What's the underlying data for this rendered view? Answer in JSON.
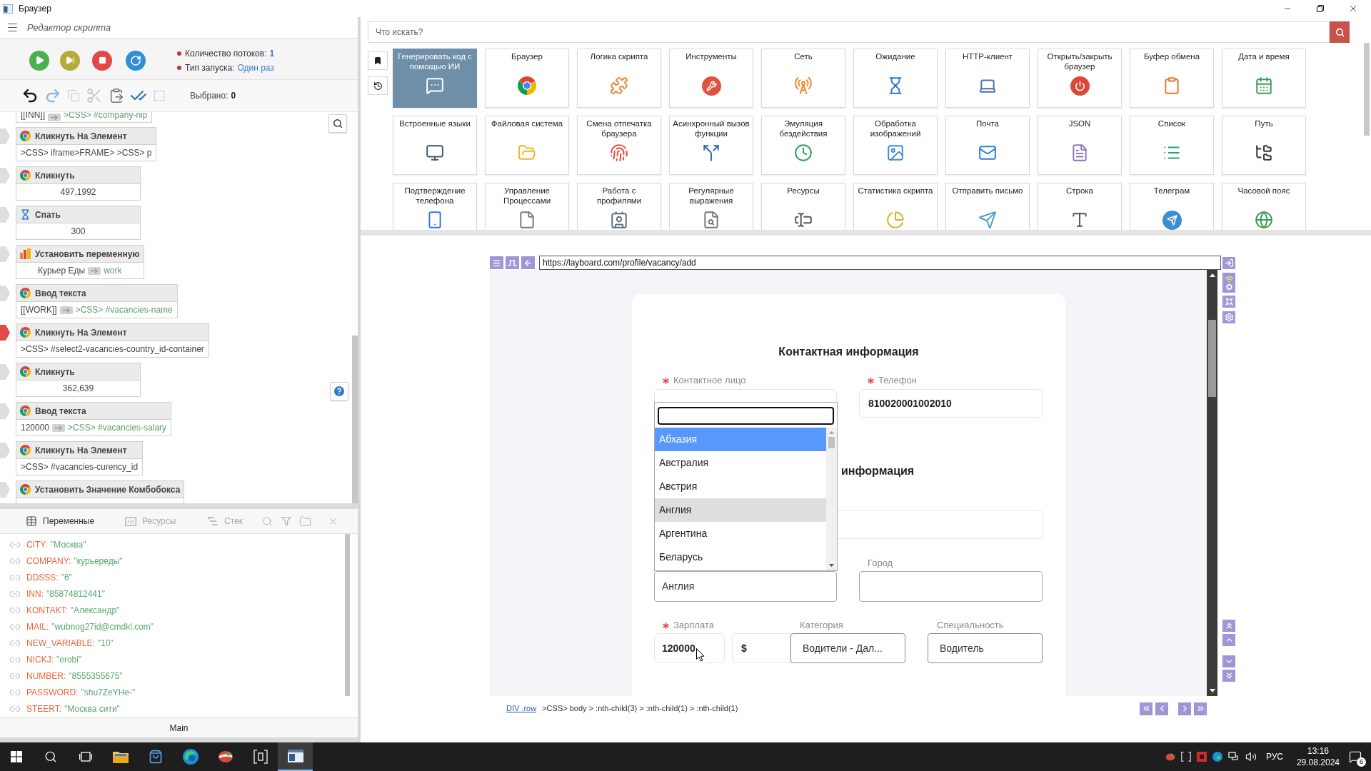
{
  "window": {
    "title": "Браузер"
  },
  "editor": {
    "title": "Редактор скрипта",
    "threads_label": "Количество потоков:",
    "threads_value": "1",
    "launch_label": "Тип запуска:",
    "launch_value": "Один раз",
    "selected_label": "Выбрано:",
    "selected_value": "0",
    "top_parameter": {
      "text": "[[INN]]",
      "target": ">CSS> #company-nip"
    },
    "blocks": [
      {
        "kind": "browser",
        "title": "Кликнуть На Элемент",
        "current": false,
        "body": {
          "text": ">CSS> iframe>FRAME> >CSS> p"
        }
      },
      {
        "kind": "browser",
        "title": "Кликнуть",
        "current": false,
        "body": {
          "text": "497,1992"
        }
      },
      {
        "kind": "wait",
        "title": "Спать",
        "current": false,
        "body": {
          "text": "300"
        }
      },
      {
        "kind": "variable",
        "title": "Установить переменную",
        "current": false,
        "body": {
          "text": "Курьер Еды",
          "target": "work"
        }
      },
      {
        "kind": "browser",
        "title": "Ввод текста",
        "current": false,
        "body": {
          "text": "[[WORK]]",
          "target": ">CSS> #vacancies-name"
        }
      },
      {
        "kind": "browser",
        "title": "Кликнуть На Элемент",
        "current": true,
        "body": {
          "text": ">CSS> #select2-vacancies-country_id-container"
        }
      },
      {
        "kind": "browser",
        "title": "Кликнуть",
        "current": false,
        "body": {
          "text": "362,639"
        }
      },
      {
        "kind": "browser",
        "title": "Ввод текста",
        "current": false,
        "body": {
          "text": "120000",
          "target": ">CSS> #vacancies-salary"
        }
      },
      {
        "kind": "browser",
        "title": "Кликнуть На Элемент",
        "current": false,
        "body": {
          "text": ">CSS> #vacancies-curency_id"
        }
      },
      {
        "kind": "browser",
        "title": "Установить Значение Комбобокса",
        "current": false
      }
    ]
  },
  "variables": {
    "tabs": [
      {
        "label": "Переменные",
        "selected": true
      },
      {
        "label": "Ресурсы",
        "selected": false
      },
      {
        "label": "Стек",
        "selected": false
      }
    ],
    "items": [
      {
        "name": "CITY:",
        "value": "\"Москва\""
      },
      {
        "name": "COMPANY:",
        "value": "\"курьереды\""
      },
      {
        "name": "DDSSS:",
        "value": "\"6\""
      },
      {
        "name": "INN:",
        "value": "\"85874812441\""
      },
      {
        "name": "KONTAKT:",
        "value": "\"Александр\""
      },
      {
        "name": "MAIL:",
        "value": "\"wubnog27id@cmdkl.com\""
      },
      {
        "name": "NEW_VARIABLE:",
        "value": "\"10\""
      },
      {
        "name": "NICKJ:",
        "value": "\"erobi\""
      },
      {
        "name": "NUMBER:",
        "value": "\"8555355675\""
      },
      {
        "name": "PASSWORD:",
        "value": "\"shu7ZeYHe-\""
      },
      {
        "name": "STEERT:",
        "value": "\"Москва сити\""
      }
    ],
    "footer": "Main"
  },
  "toolbox": {
    "search_placeholder": "Что искать?",
    "tiles": [
      {
        "label": "Генерировать код с помощью ИИ",
        "featured": true
      },
      {
        "label": "Браузер",
        "featured": false
      },
      {
        "label": "Логика скрипта",
        "featured": false
      },
      {
        "label": "Инструменты",
        "featured": false
      },
      {
        "label": "Сеть",
        "featured": false
      },
      {
        "label": "Ожидание",
        "featured": false
      },
      {
        "label": "HTTP-клиент",
        "featured": false
      },
      {
        "label": "Открыть/закрыть браузер",
        "featured": false
      },
      {
        "label": "Буфер обмена",
        "featured": false
      },
      {
        "label": "Дата и время",
        "featured": false
      },
      {
        "label": "Встроенные языки",
        "featured": false
      },
      {
        "label": "Файловая система",
        "featured": false
      },
      {
        "label": "Смена отпечатка браузера",
        "featured": false
      },
      {
        "label": "Асинхронный вызов функции",
        "featured": false
      },
      {
        "label": "Эмуляция бездействия",
        "featured": false
      },
      {
        "label": "Обработка изображений",
        "featured": false
      },
      {
        "label": "Почта",
        "featured": false
      },
      {
        "label": "JSON",
        "featured": false
      },
      {
        "label": "Список",
        "featured": false
      },
      {
        "label": "Путь",
        "featured": false
      },
      {
        "label": "Подтверждение телефона",
        "featured": false
      },
      {
        "label": "Управление Процессами",
        "featured": false
      },
      {
        "label": "Работа с профилями",
        "featured": false
      },
      {
        "label": "Регулярные выражения",
        "featured": false
      },
      {
        "label": "Ресурсы",
        "featured": false
      },
      {
        "label": "Статистика скрипта",
        "featured": false
      },
      {
        "label": "Отправить письмо",
        "featured": false
      },
      {
        "label": "Строка",
        "featured": false
      },
      {
        "label": "Телеграм",
        "featured": false
      },
      {
        "label": "Часовой пояс",
        "featured": false
      }
    ]
  },
  "page": {
    "url": "https://layboard.com/profile/vacancy/add",
    "section_title": "Контактная информация",
    "contact": {
      "label": "Контактное лицо",
      "required": true
    },
    "phone": {
      "label": "Телефон",
      "required": true,
      "value": "810020001002010"
    },
    "dropdown": {
      "options": [
        {
          "label": "Абхазия",
          "selected": true,
          "hovered": false
        },
        {
          "label": "Австралия",
          "selected": false,
          "hovered": false
        },
        {
          "label": "Австрия",
          "selected": false,
          "hovered": false
        },
        {
          "label": "Англия",
          "selected": false,
          "hovered": true
        },
        {
          "label": "Аргентина",
          "selected": false,
          "hovered": false
        },
        {
          "label": "Беларусь",
          "selected": false,
          "hovered": false
        }
      ]
    },
    "second_section_title": "информация",
    "country": {
      "value": "Англия"
    },
    "city": {
      "label": "Город"
    },
    "salary": {
      "label": "Зарплата",
      "required": true,
      "value": "120000"
    },
    "currency": {
      "value": "$"
    },
    "category": {
      "label": "Категория",
      "value": "Водители - Дал..."
    },
    "specialty": {
      "label": "Специальность",
      "value": "Водитель"
    },
    "element_tag": "DIV .row",
    "selector": ">CSS> body > :nth-child(3) > :nth-child(1) > :nth-child(1)"
  },
  "taskbar": {
    "lang": "РУС",
    "time": "13:16",
    "date": "29.08.2024",
    "notifications": "6"
  }
}
